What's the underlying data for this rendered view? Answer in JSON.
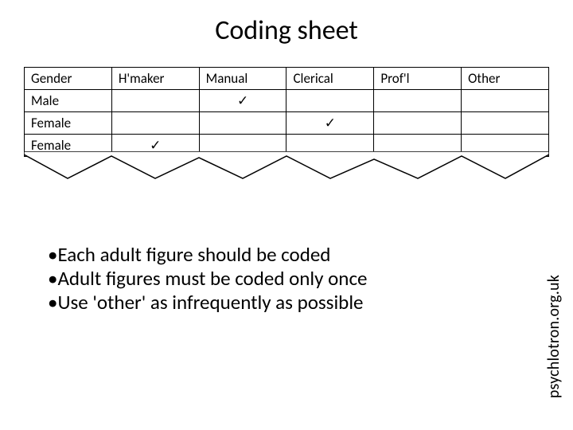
{
  "title": "Coding sheet",
  "table": {
    "headers": [
      "Gender",
      "H'maker",
      "Manual",
      "Clerical",
      "Prof'l",
      "Other"
    ],
    "rows": [
      {
        "gender": "Male",
        "hmaker": "",
        "manual": "✓",
        "clerical": "",
        "profl": "",
        "other": ""
      },
      {
        "gender": "Female",
        "hmaker": "",
        "manual": "",
        "clerical": "✓",
        "profl": "",
        "other": ""
      },
      {
        "gender": "Female",
        "hmaker": "✓",
        "manual": "",
        "clerical": "",
        "profl": "",
        "other": ""
      }
    ]
  },
  "bullets": [
    "•Each adult figure should be coded",
    "•Adult figures must be coded only once",
    "•Use 'other' as infrequently as possible"
  ],
  "side_text": "psychlotron.org.uk",
  "chart_data": {
    "type": "table",
    "title": "Coding sheet",
    "columns": [
      "Gender",
      "H'maker",
      "Manual",
      "Clerical",
      "Prof'l",
      "Other"
    ],
    "rows": [
      [
        "Male",
        "",
        "✓",
        "",
        "",
        ""
      ],
      [
        "Female",
        "",
        "",
        "✓",
        "",
        ""
      ],
      [
        "Female",
        "✓",
        "",
        "",
        "",
        ""
      ]
    ]
  }
}
